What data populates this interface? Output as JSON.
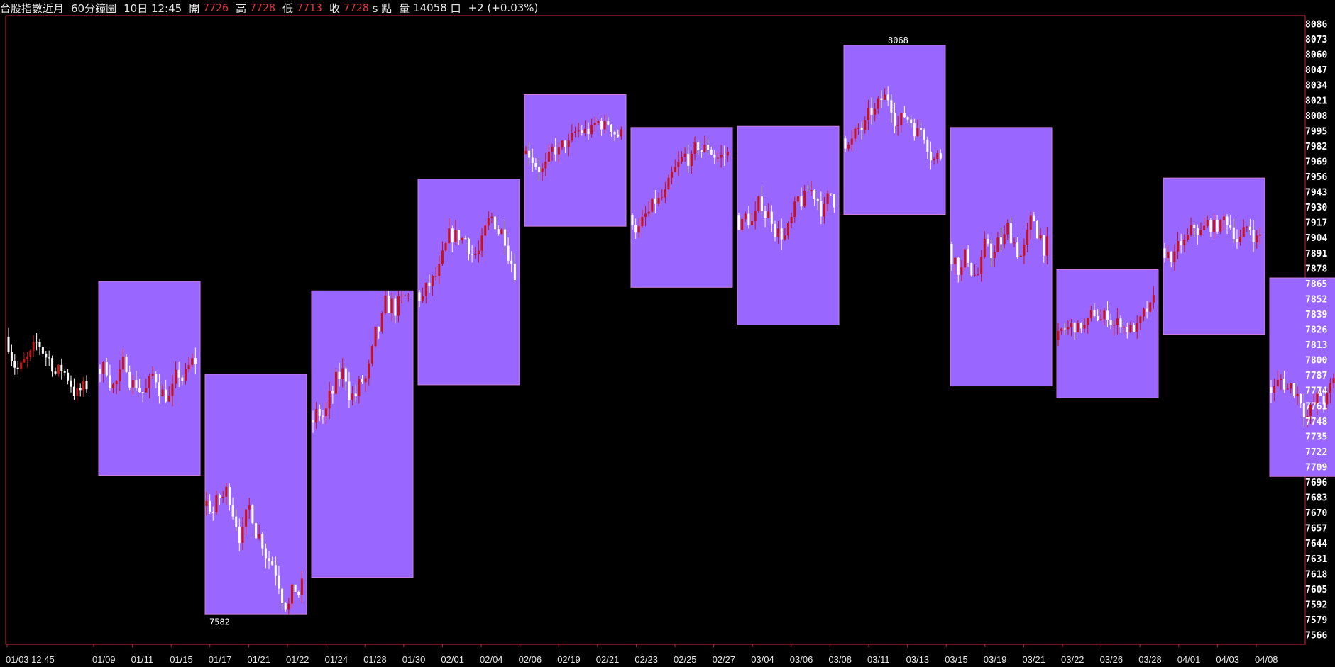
{
  "header": {
    "symbol": "台股指數近月",
    "period": "60分鐘圖",
    "time": "10日 12:45",
    "open_label": "開",
    "open": "7726",
    "high_label": "高",
    "high": "7728",
    "low_label": "低",
    "low": "7713",
    "close_label": "收",
    "close": "7728",
    "unit": "s 點",
    "volume_label": "量",
    "volume": "14058",
    "volume_unit": "口",
    "change": "+2 (+0.03%)"
  },
  "colors": {
    "background": "#000000",
    "frame": "#cc2244",
    "box_fill": "#9966ff",
    "box_stroke": "#d080e0",
    "up_candle": "#cc1111",
    "down_candle": "#ffffff",
    "axis_text": "#ffffff"
  },
  "chart_data": {
    "type": "candlestick",
    "grid": false,
    "ylim": [
      7566,
      8086
    ],
    "y_ticks": [
      8086,
      8073,
      8060,
      8047,
      8034,
      8021,
      8008,
      7995,
      7982,
      7969,
      7956,
      7943,
      7930,
      7917,
      7904,
      7891,
      7878,
      7865,
      7852,
      7839,
      7826,
      7813,
      7800,
      7787,
      7774,
      7761,
      7748,
      7735,
      7722,
      7709,
      7696,
      7683,
      7670,
      7657,
      7644,
      7631,
      7618,
      7605,
      7592,
      7579,
      7566
    ],
    "x_labels": [
      "01/03 12:45",
      "01/09",
      "01/11",
      "01/15",
      "01/17",
      "01/21",
      "01/22",
      "01/24",
      "01/28",
      "01/30",
      "02/01",
      "02/04",
      "02/06",
      "02/19",
      "02/21",
      "02/23",
      "02/25",
      "02/27",
      "03/04",
      "03/06",
      "03/08",
      "03/11",
      "03/13",
      "03/15",
      "03/19",
      "03/21",
      "03/22",
      "03/26",
      "03/28",
      "04/01",
      "04/03",
      "04/08"
    ],
    "period_boxes": [
      {
        "low": 7702,
        "high": 7867
      },
      {
        "low": 7584,
        "high": 7788
      },
      {
        "low": 7615,
        "high": 7859
      },
      {
        "low": 7779,
        "high": 7954
      },
      {
        "low": 7914,
        "high": 8026
      },
      {
        "low": 7862,
        "high": 7998
      },
      {
        "low": 7830,
        "high": 7999
      },
      {
        "low": 7924,
        "high": 8068
      },
      {
        "low": 7778,
        "high": 7998
      },
      {
        "low": 7768,
        "high": 7877
      },
      {
        "low": 7822,
        "high": 7955
      },
      {
        "low": 7701,
        "high": 7870
      }
    ],
    "period_highs": [
      7867,
      7788,
      7859,
      7954,
      8026,
      7998,
      7999,
      8068,
      7998,
      7877,
      7955,
      7870
    ],
    "period_lows": [
      7702,
      7584,
      7615,
      7779,
      7914,
      7862,
      7830,
      7924,
      7778,
      7768,
      7822,
      7701
    ],
    "annotations": [
      {
        "text": "8068",
        "value": 8068,
        "position": "above"
      },
      {
        "text": "7582",
        "value": 7582,
        "position": "below"
      }
    ]
  }
}
